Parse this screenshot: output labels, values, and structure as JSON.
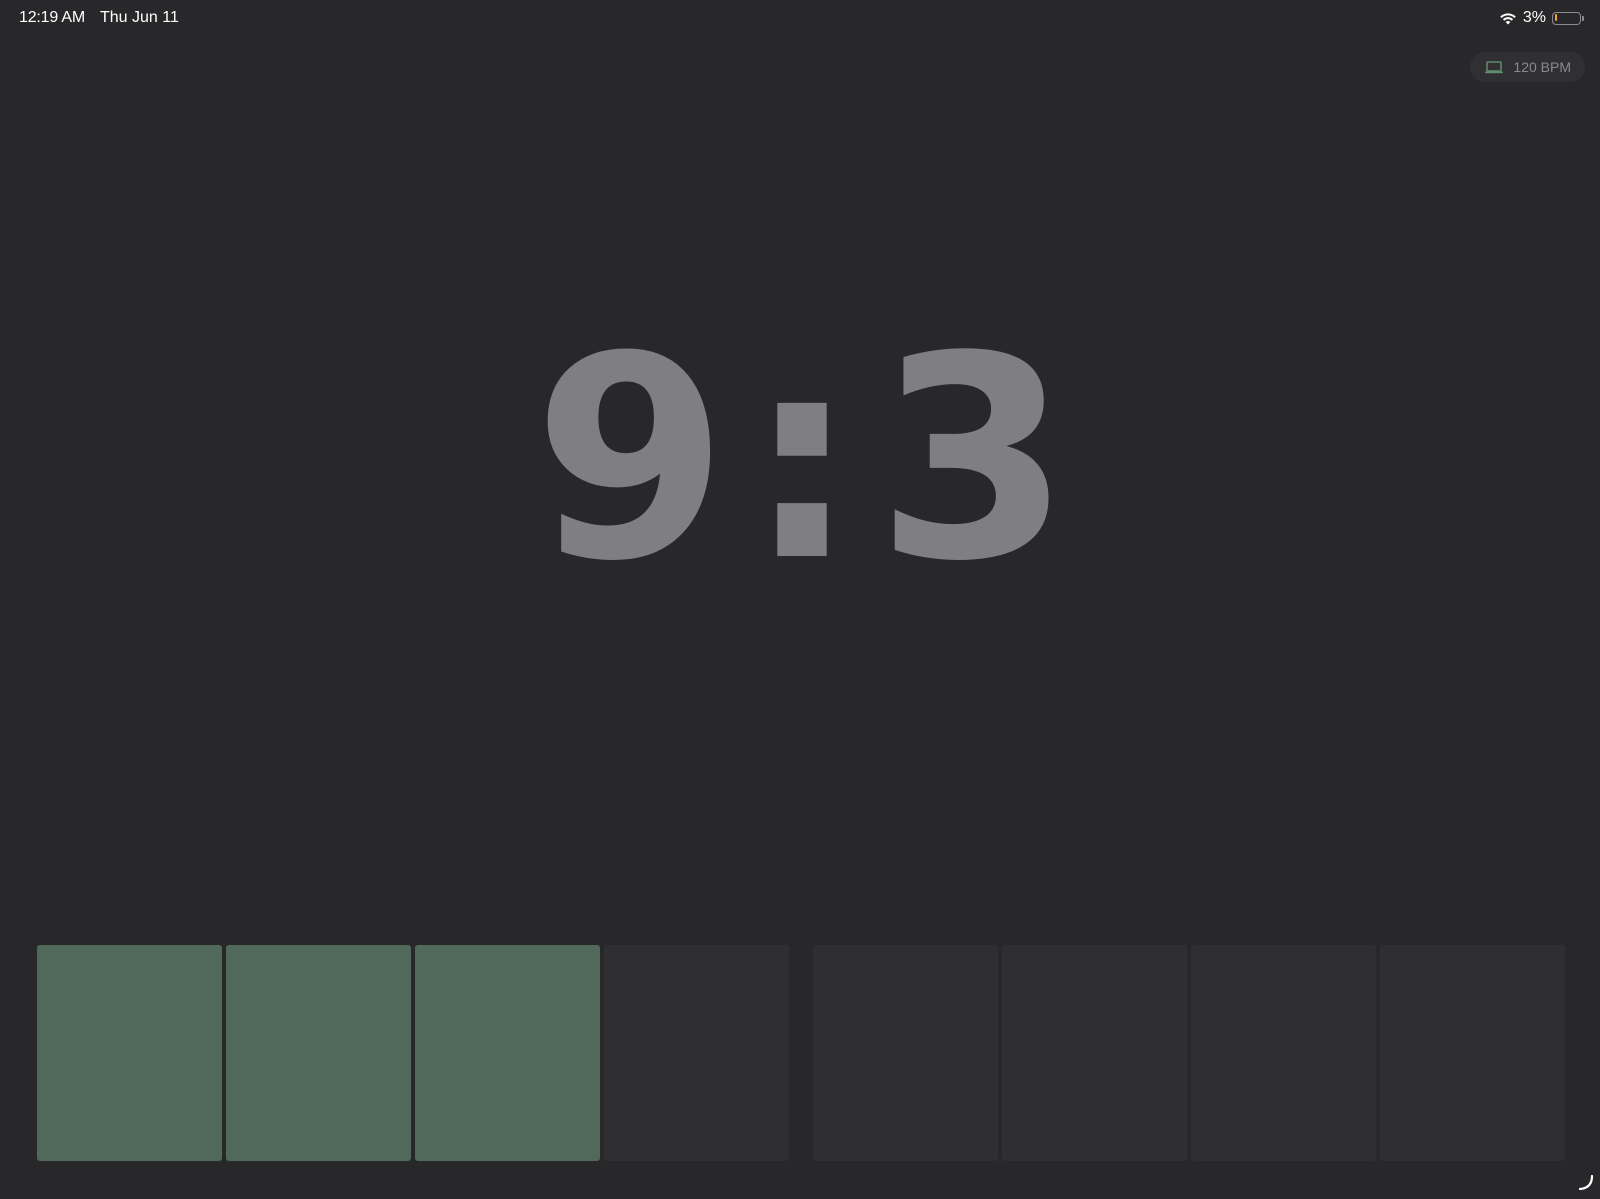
{
  "status_bar": {
    "time": "12:19 AM",
    "date": "Thu Jun 11",
    "battery_percent": "3%",
    "battery_level": 0.03,
    "wifi_icon": "wifi-icon",
    "battery_icon": "battery-icon"
  },
  "tempo": {
    "label": "120 BPM",
    "icon": "laptop-icon",
    "icon_color": "#5f8c6e"
  },
  "counter": {
    "bar": "9",
    "separator": ":",
    "beat": "3"
  },
  "beats": {
    "total": 8,
    "active_count": 3,
    "active_color": "#51695a",
    "inactive_color": "#2f2f31"
  }
}
